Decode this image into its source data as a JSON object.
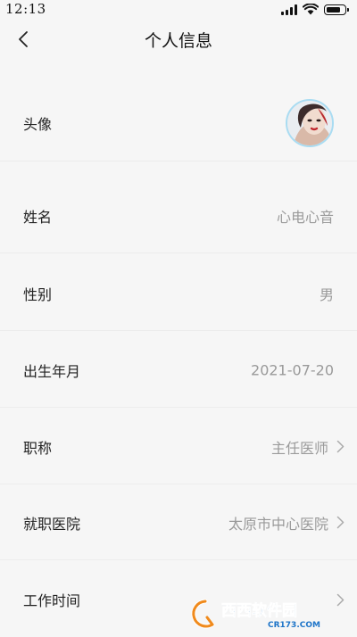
{
  "status_bar": {
    "time": "12:13",
    "battery_level": 0.85
  },
  "nav": {
    "title": "个人信息",
    "back_icon": "chevron-left-icon"
  },
  "avatar_row": {
    "label": "头像"
  },
  "rows": [
    {
      "label": "姓名",
      "value": "心电心音"
    },
    {
      "label": "性别",
      "value": "男"
    },
    {
      "label": "出生年月",
      "value": "2021-07-20"
    },
    {
      "label": "职称",
      "value": "主任医师"
    },
    {
      "label": "就职医院",
      "value": "太原市中心医院"
    },
    {
      "label": "工作时间",
      "value": ""
    }
  ],
  "watermark": {
    "brand": "西西软件园",
    "site": "CR173.COM"
  }
}
